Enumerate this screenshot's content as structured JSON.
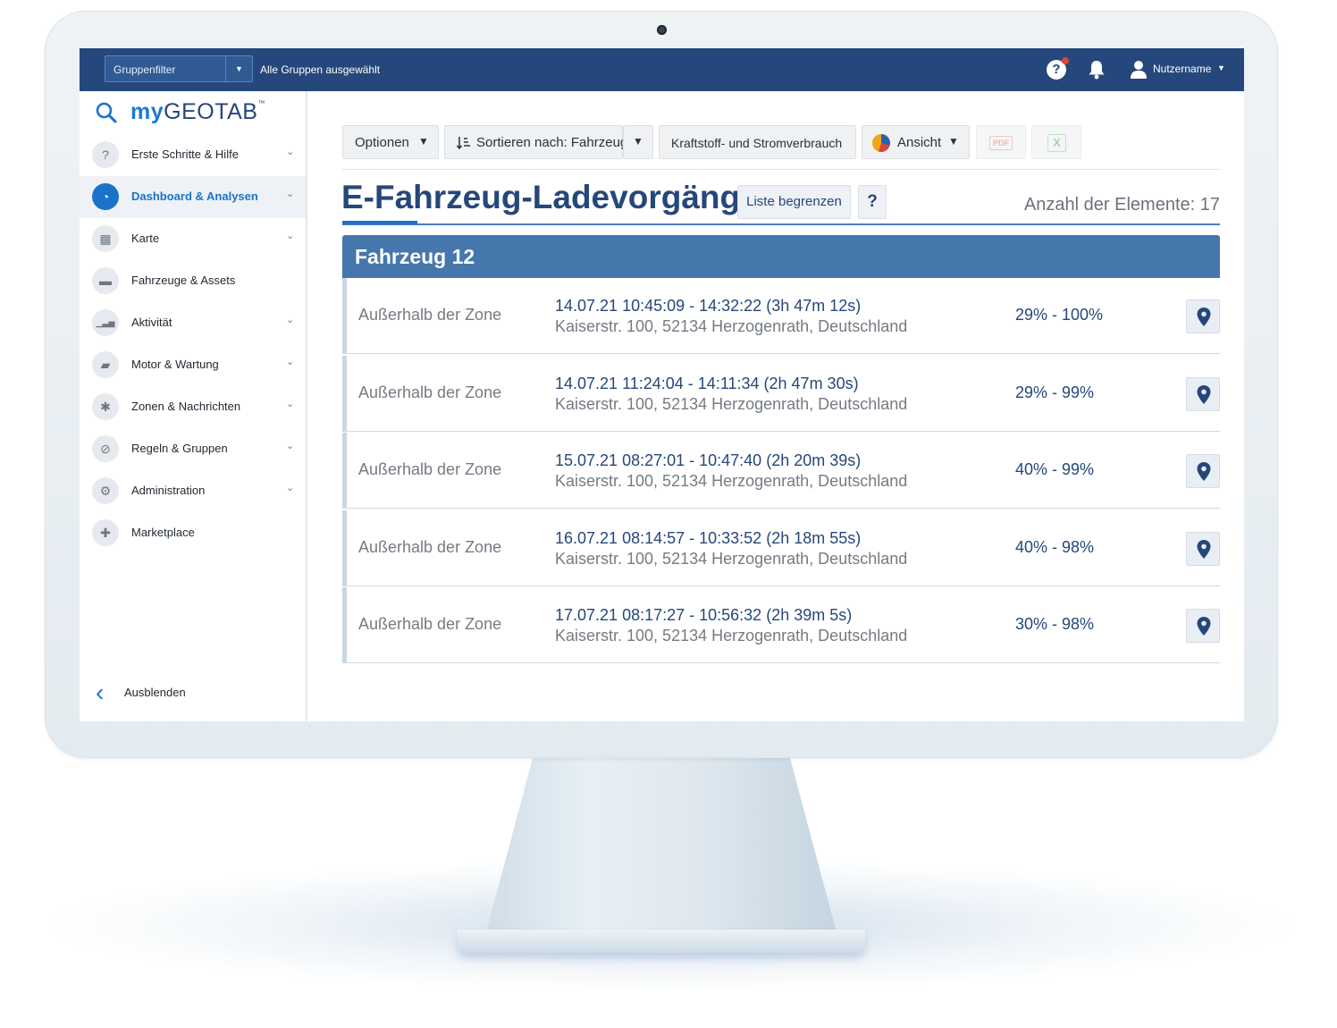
{
  "topbar": {
    "group_filter_label": "Gruppenfilter",
    "group_filter_caret": "▼",
    "group_status": "Alle Gruppen ausgewählt",
    "help_icon": "help-circle-icon",
    "help_glyph": "?",
    "bell_icon": "bell-icon",
    "user_icon": "user-icon",
    "username": "Nutzername",
    "username_caret": "▼",
    "colors": {
      "bar": "#25477b",
      "notification_dot": "#e0433a"
    }
  },
  "sidebar": {
    "logo": {
      "my": "my",
      "brand": "GEOTAB",
      "tm": "™"
    },
    "items": [
      {
        "label": "Erste Schritte & Hilfe",
        "icon": "question-icon",
        "glyph": "?",
        "caret": "⌄",
        "active": false
      },
      {
        "label": "Dashboard & Analysen",
        "icon": "dashboard-gauge-icon",
        "glyph": "◔",
        "caret": "⌄",
        "active": true
      },
      {
        "label": "Karte",
        "icon": "map-icon",
        "glyph": "▦",
        "caret": "⌄",
        "active": false
      },
      {
        "label": "Fahrzeuge & Assets",
        "icon": "truck-icon",
        "glyph": "▬",
        "caret": "",
        "active": false
      },
      {
        "label": "Aktivität",
        "icon": "activity-chart-icon",
        "glyph": "▁▃▅",
        "caret": "⌄",
        "active": false
      },
      {
        "label": "Motor & Wartung",
        "icon": "engine-icon",
        "glyph": "▰",
        "caret": "⌄",
        "active": false
      },
      {
        "label": "Zonen & Nachrichten",
        "icon": "zones-icon",
        "glyph": "✱",
        "caret": "⌄",
        "active": false
      },
      {
        "label": "Regeln & Gruppen",
        "icon": "rules-icon",
        "glyph": "⊘",
        "caret": "⌄",
        "active": false
      },
      {
        "label": "Administration",
        "icon": "gear-icon",
        "glyph": "⚙",
        "caret": "⌄",
        "active": false
      },
      {
        "label": "Marketplace",
        "icon": "marketplace-pin-icon",
        "glyph": "✚",
        "caret": "",
        "active": false
      }
    ],
    "hide_label": "Ausblenden",
    "hide_arrow": "‹"
  },
  "toolbar": {
    "options_label": "Optionen",
    "sort_label": "Sortieren nach: Fahrzeug",
    "fuel_label": "Kraftstoff- und Stromverbrauch",
    "view_label": "Ansicht",
    "caret": "▼",
    "pdf_label": "PDF",
    "excel_label": "X"
  },
  "page": {
    "title": "E-Fahrzeug-Ladevorgänge",
    "limit_button": "Liste begrenzen",
    "help_button": "?",
    "count_label": "Anzahl der Elemente: 17",
    "group_title": "Fahrzeug 12"
  },
  "rows": [
    {
      "zone": "Außerhalb der Zone",
      "time": "14.07.21 10:45:09 - 14:32:22 (3h 47m 12s)",
      "address": "Kaiserstr. 100, 52134 Herzogenrath, Deutschland",
      "charge": "29% - 100%"
    },
    {
      "zone": "Außerhalb der Zone",
      "time": "14.07.21 11:24:04 - 14:11:34 (2h 47m 30s)",
      "address": "Kaiserstr. 100, 52134 Herzogenrath, Deutschland",
      "charge": "29% - 99%"
    },
    {
      "zone": "Außerhalb der Zone",
      "time": "15.07.21 08:27:01 - 10:47:40 (2h 20m 39s)",
      "address": "Kaiserstr. 100, 52134 Herzogenrath, Deutschland",
      "charge": "40% - 99%"
    },
    {
      "zone": "Außerhalb der Zone",
      "time": "16.07.21 08:14:57 - 10:33:52 (2h 18m 55s)",
      "address": "Kaiserstr. 100, 52134 Herzogenrath, Deutschland",
      "charge": "40% - 98%"
    },
    {
      "zone": "Außerhalb der Zone",
      "time": "17.07.21 08:17:27 - 10:56:32 (2h 39m 5s)",
      "address": "Kaiserstr. 100, 52134 Herzogenrath, Deutschland",
      "charge": "30% - 98%"
    }
  ],
  "colors": {
    "accent": "#1b73c9",
    "brand_navy": "#25477b",
    "group_header": "#4577ad"
  }
}
